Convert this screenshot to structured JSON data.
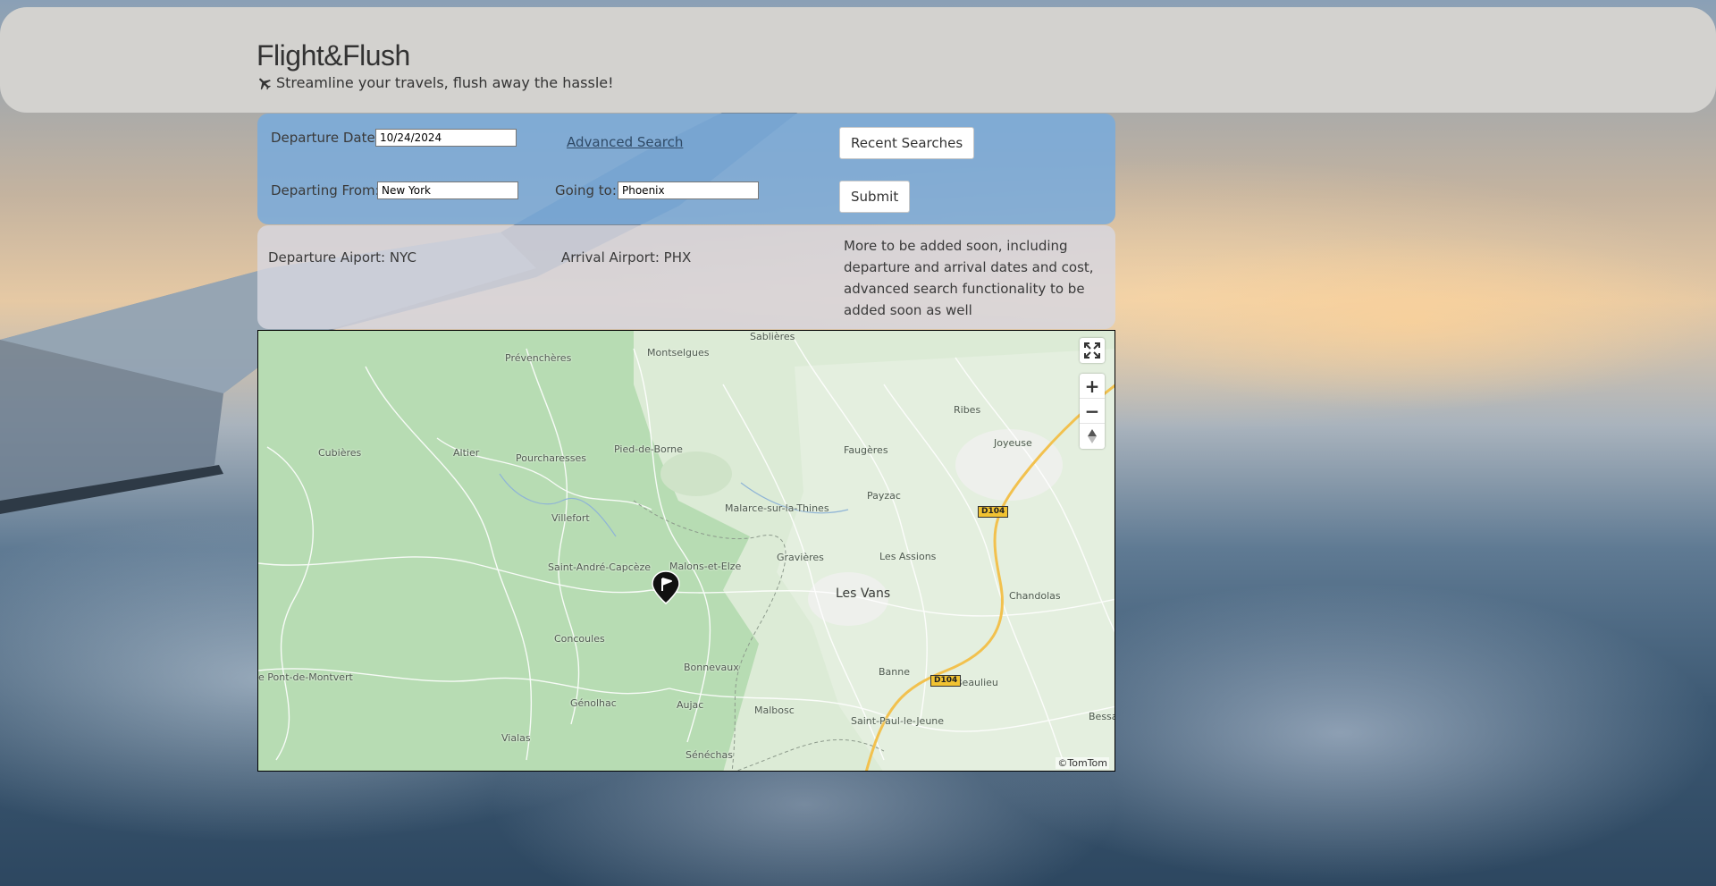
{
  "header": {
    "title": "Flight&Flush",
    "tagline": "Streamline your travels, flush away the hassle!"
  },
  "search": {
    "departure_date_label": "Departure Date:",
    "departure_date_value": "10/24/2024",
    "advanced_search_label": "Advanced Search",
    "recent_searches_label": "Recent Searches",
    "departing_from_label": "Departing From:",
    "departing_from_value": "New York",
    "going_to_label": "Going to:",
    "going_to_value": "Phoenix",
    "submit_label": "Submit"
  },
  "info": {
    "departure_airport": "Departure Aiport: NYC",
    "arrival_airport": "Arrival Airport: PHX",
    "note": "More to be added soon, including departure and arrival dates and cost, advanced search functionality to be added soon as well"
  },
  "map": {
    "attribution": "©TomTom",
    "zoom_in": "+",
    "zoom_out": "−",
    "labels": {
      "sablieres": "Sablières",
      "prevencheres": "Prévenchères",
      "montselgues": "Montselgues",
      "ribes": "Ribes",
      "joyeuse": "Joyeuse",
      "cubieres": "Cubières",
      "altier": "Altier",
      "pourcharesses": "Pourcharesses",
      "pied_de_borne": "Pied-de-Borne",
      "faugeres": "Faugères",
      "payzac": "Payzac",
      "villefort": "Villefort",
      "malarce": "Malarce-sur-la-Thines",
      "saint_andre": "Saint-André-Capcèze",
      "malons": "Malons-et-Elze",
      "gravieres": "Gravières",
      "les_assions": "Les Assions",
      "les_vans": "Les Vans",
      "chandolas": "Chandolas",
      "concoules": "Concoules",
      "bonnevaux": "Bonnevaux",
      "pont_de_montvert": "e Pont-de-Montvert",
      "banne": "Banne",
      "beaulieu": "Beaulieu",
      "genolhac": "Génolhac",
      "aujac": "Aujac",
      "malbosc": "Malbosc",
      "saint_paul": "Saint-Paul-le-Jeune",
      "bessa": "Bessa",
      "vialas": "Vialas",
      "senechas": "Sénéchas",
      "road_d104": "D104"
    }
  },
  "colors": {
    "header_bg": "#d3d2cf",
    "search_panel_bg": "#78aadc",
    "info_panel_bg": "#d7d7e1",
    "map_forest": "#b5dcb0",
    "map_light": "#dcebd6"
  }
}
